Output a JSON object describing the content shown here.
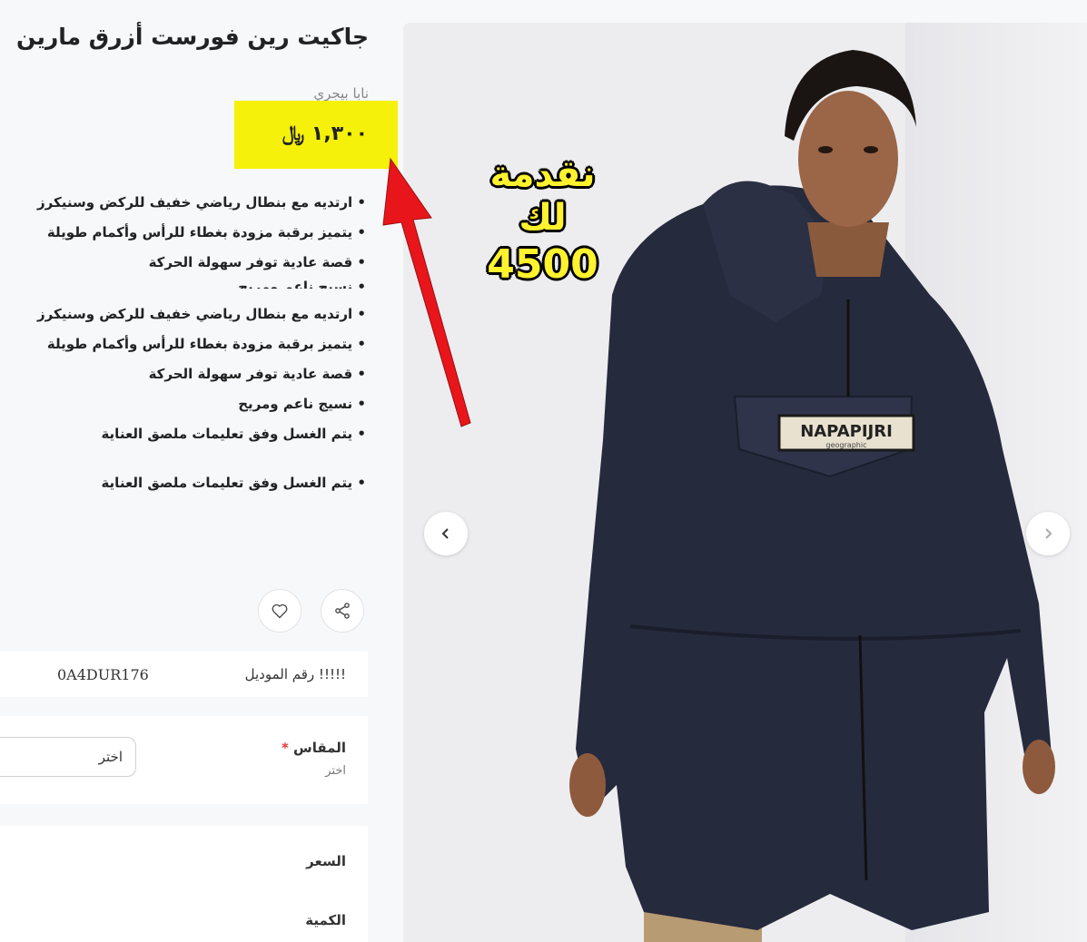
{
  "product": {
    "title": "جاكيت رين فورست أزرق مارين",
    "brand": "نابا بيجري",
    "price": "١,٣٠٠ ﷼"
  },
  "promo": {
    "line1": "نقدمة لك",
    "line2": "4500"
  },
  "features": [
    "• ارتديه مع بنطال رياضي خفيف للركض وسنيكرز",
    "• يتميز برقبة مزودة بغطاء للرأس وأكمام طويلة",
    "• قصة عادية توفر سهولة الحركة",
    "• نسيج ناعم ومريح",
    "• ارتديه مع بنطال رياضي خفيف للركض وسنيكرز",
    "• يتميز برقبة مزودة بغطاء للرأس وأكمام طويلة",
    "• قصة عادية توفر سهولة الحركة",
    "• نسيج ناعم ومريح",
    "• يتم الغسل وفق تعليمات ملصق العناية",
    "• يتم الغسل وفق تعليمات ملصق العناية"
  ],
  "model": {
    "label": "!!!!! رقم الموديل",
    "value": "0A4DUR176"
  },
  "size": {
    "label": "المقاس",
    "required_mark": "*",
    "sub": "اختر",
    "select_value": "اختر"
  },
  "summary": {
    "price_label": "السعر",
    "quantity_label": "الكمية"
  },
  "image_logo_text": "NAPAPIJRI",
  "image_logo_sub": "geographic",
  "colors": {
    "highlight": "#f5f10a",
    "arrow": "#e8161b",
    "promo_text": "#fff22e",
    "jacket": "#262a3d"
  },
  "icons": {
    "prev": "chevron-left-icon",
    "next": "chevron-right-icon",
    "share": "share-icon",
    "wishlist": "heart-icon"
  }
}
